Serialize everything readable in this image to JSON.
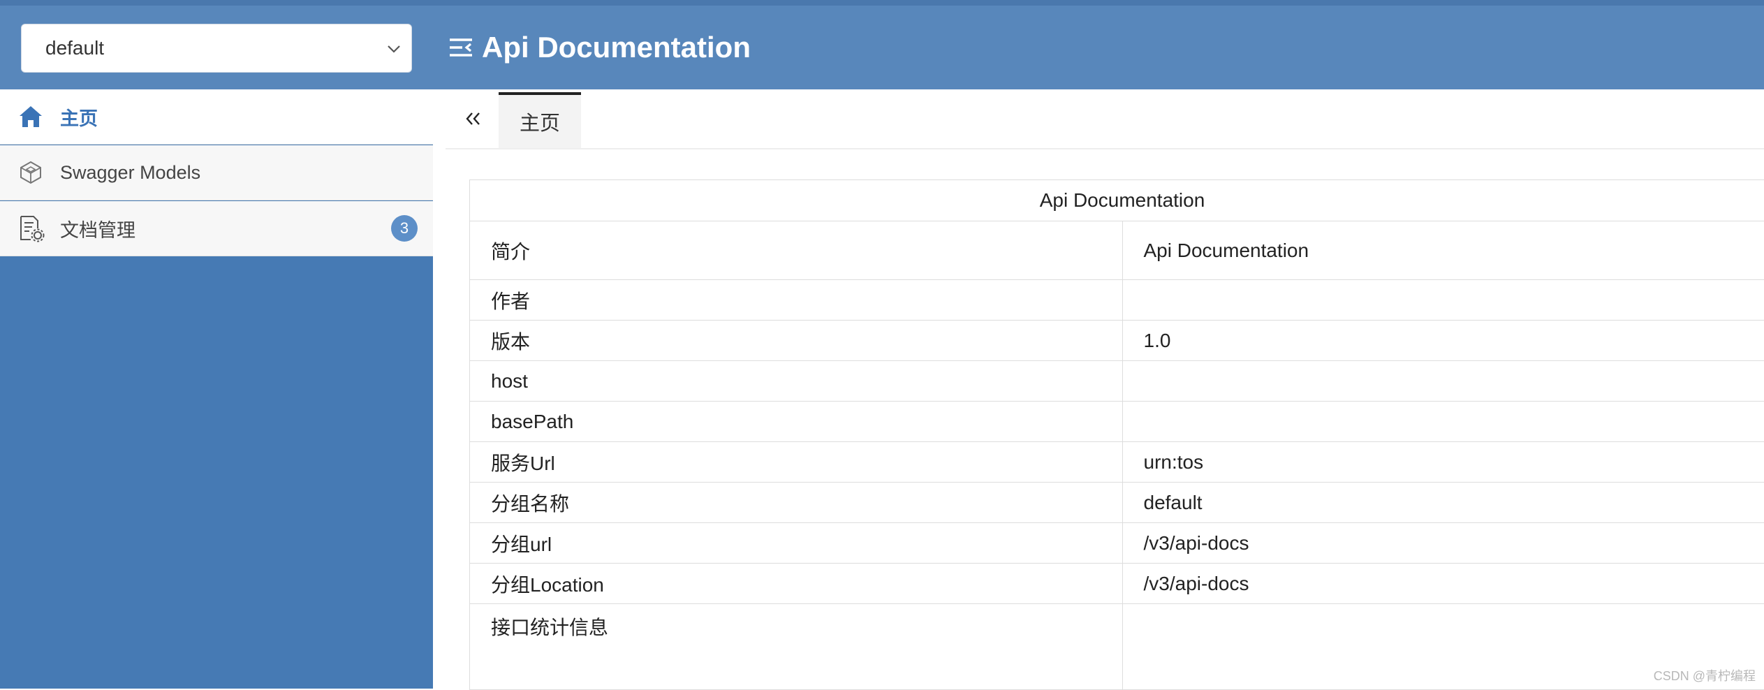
{
  "header": {
    "group_select_value": "default",
    "title": "Api Documentation",
    "color": "#5887bb"
  },
  "sidebar": {
    "items": [
      {
        "label": "主页",
        "icon": "home-icon",
        "active": true
      },
      {
        "label": "Swagger Models",
        "icon": "models-cube-icon"
      },
      {
        "label": "文档管理",
        "icon": "doc-settings-icon",
        "badge": "3"
      }
    ],
    "background": "#467ab4"
  },
  "tabs": {
    "items": [
      {
        "label": "主页",
        "active": true
      }
    ]
  },
  "info_table": {
    "caption": "Api Documentation",
    "rows": [
      {
        "key": "简介",
        "value": "Api Documentation"
      },
      {
        "key": "作者",
        "value": ""
      },
      {
        "key": "版本",
        "value": "1.0"
      },
      {
        "key": "host",
        "value": ""
      },
      {
        "key": "basePath",
        "value": ""
      },
      {
        "key": "服务Url",
        "value": "urn:tos"
      },
      {
        "key": "分组名称",
        "value": "default"
      },
      {
        "key": "分组url",
        "value": "/v3/api-docs"
      },
      {
        "key": "分组Location",
        "value": "/v3/api-docs"
      },
      {
        "key": "接口统计信息",
        "value": ""
      }
    ]
  },
  "watermark": "CSDN @青柠编程"
}
